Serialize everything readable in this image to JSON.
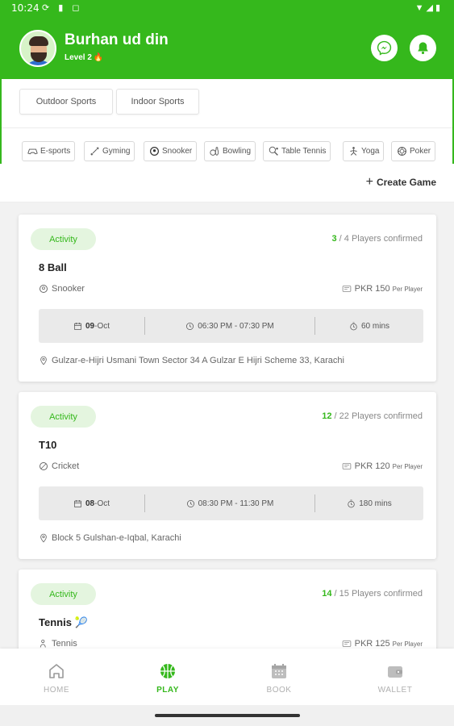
{
  "status_bar": {
    "time": "10:24",
    "left_icons": "⟳ ▮ ◻",
    "right_icons": "▼◢▮"
  },
  "header": {
    "user_name": "Burhan ud din",
    "level": "Level 2",
    "accent_color": "#35b81c"
  },
  "categories": {
    "tabs": [
      {
        "label": "Outdoor Sports"
      },
      {
        "label": "Indoor Sports"
      }
    ],
    "chips": [
      {
        "label": "E-sports",
        "icon": "gamepad-icon"
      },
      {
        "label": "Gyming",
        "icon": "dumbbell-icon"
      },
      {
        "label": "Snooker",
        "icon": "snooker-ball-icon"
      },
      {
        "label": "Bowling",
        "icon": "bowling-icon"
      },
      {
        "label": "Table Tennis",
        "icon": "table-tennis-icon"
      },
      {
        "label": "Yoga",
        "icon": "yoga-icon"
      },
      {
        "label": "Poker",
        "icon": "poker-chip-icon"
      }
    ]
  },
  "actions": {
    "create_game": "Create Game"
  },
  "games": [
    {
      "badge": "Activity",
      "confirmed_count": "3",
      "confirmed_rest": " / 4 Players confirmed",
      "title": "8 Ball",
      "sport": "Snooker",
      "price": "PKR 150",
      "price_unit": "Per Player",
      "date_day": "09",
      "date_month": "-Oct",
      "time": "06:30 PM - 07:30 PM",
      "duration": "60 mins",
      "address": "Gulzar-e-Hijri Usmani Town Sector 34 A Gulzar E Hijri Scheme 33, Karachi"
    },
    {
      "badge": "Activity",
      "confirmed_count": "12",
      "confirmed_rest": " / 22 Players confirmed",
      "title": "T10",
      "sport": "Cricket",
      "price": "PKR 120",
      "price_unit": "Per Player",
      "date_day": "08",
      "date_month": "-Oct",
      "time": "08:30 PM - 11:30 PM",
      "duration": "180 mins",
      "address": "Block 5 Gulshan-e-Iqbal, Karachi"
    },
    {
      "badge": "Activity",
      "confirmed_count": "14",
      "confirmed_rest": " / 15 Players confirmed",
      "title": "Tennis 🎾",
      "sport": "Tennis",
      "price": "PKR 125",
      "price_unit": "Per Player"
    }
  ],
  "bottom_nav": [
    {
      "label": "HOME",
      "icon": "home-icon"
    },
    {
      "label": "PLAY",
      "icon": "basketball-icon"
    },
    {
      "label": "BOOK",
      "icon": "calendar-icon"
    },
    {
      "label": "WALLET",
      "icon": "wallet-icon"
    }
  ]
}
